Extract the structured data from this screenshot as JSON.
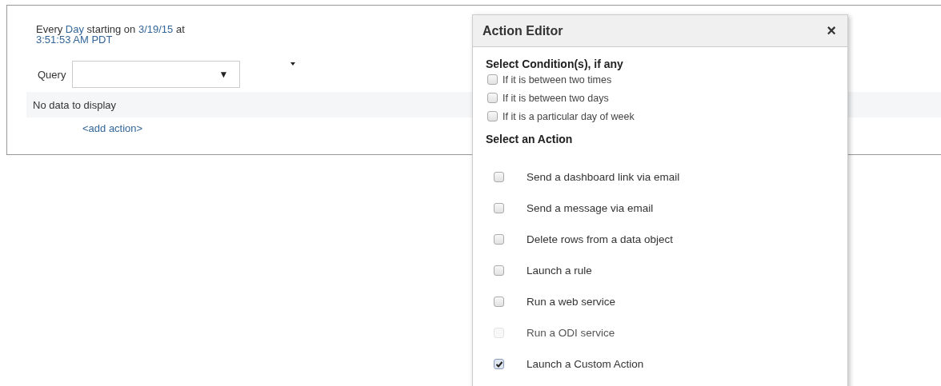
{
  "schedule": {
    "parts": [
      {
        "text": "Every",
        "kind": "plain"
      },
      {
        "text": "Day",
        "kind": "link"
      },
      {
        "text": "starting on",
        "kind": "plain"
      },
      {
        "text": "3/19/15",
        "kind": "link"
      },
      {
        "text": "at",
        "kind": "plain"
      },
      {
        "text": "3:51:53 AM PDT",
        "kind": "link"
      }
    ]
  },
  "query": {
    "label": "Query",
    "arrow": "▼"
  },
  "table": {
    "empty_message": "No data to display"
  },
  "add_action": "<add action>",
  "dialog": {
    "title": "Action Editor",
    "close": "×",
    "conditions_heading": "Select Condition(s), if any",
    "conditions": [
      {
        "label": "If it is between two times",
        "checked": false
      },
      {
        "label": "If it is between two days",
        "checked": false
      },
      {
        "label": "If it is a particular day of week",
        "checked": false
      }
    ],
    "actions_heading": "Select an Action",
    "actions": [
      {
        "label": "Send a dashboard link via email",
        "checked": false,
        "disabled": false
      },
      {
        "label": "Send a message via email",
        "checked": false,
        "disabled": false
      },
      {
        "label": "Delete rows from a data object",
        "checked": false,
        "disabled": false
      },
      {
        "label": "Launch a rule",
        "checked": false,
        "disabled": false
      },
      {
        "label": "Run a web service",
        "checked": false,
        "disabled": false
      },
      {
        "label": "Run a ODI service",
        "checked": false,
        "disabled": true
      },
      {
        "label": "Launch a Custom Action",
        "checked": true,
        "disabled": false
      }
    ]
  }
}
